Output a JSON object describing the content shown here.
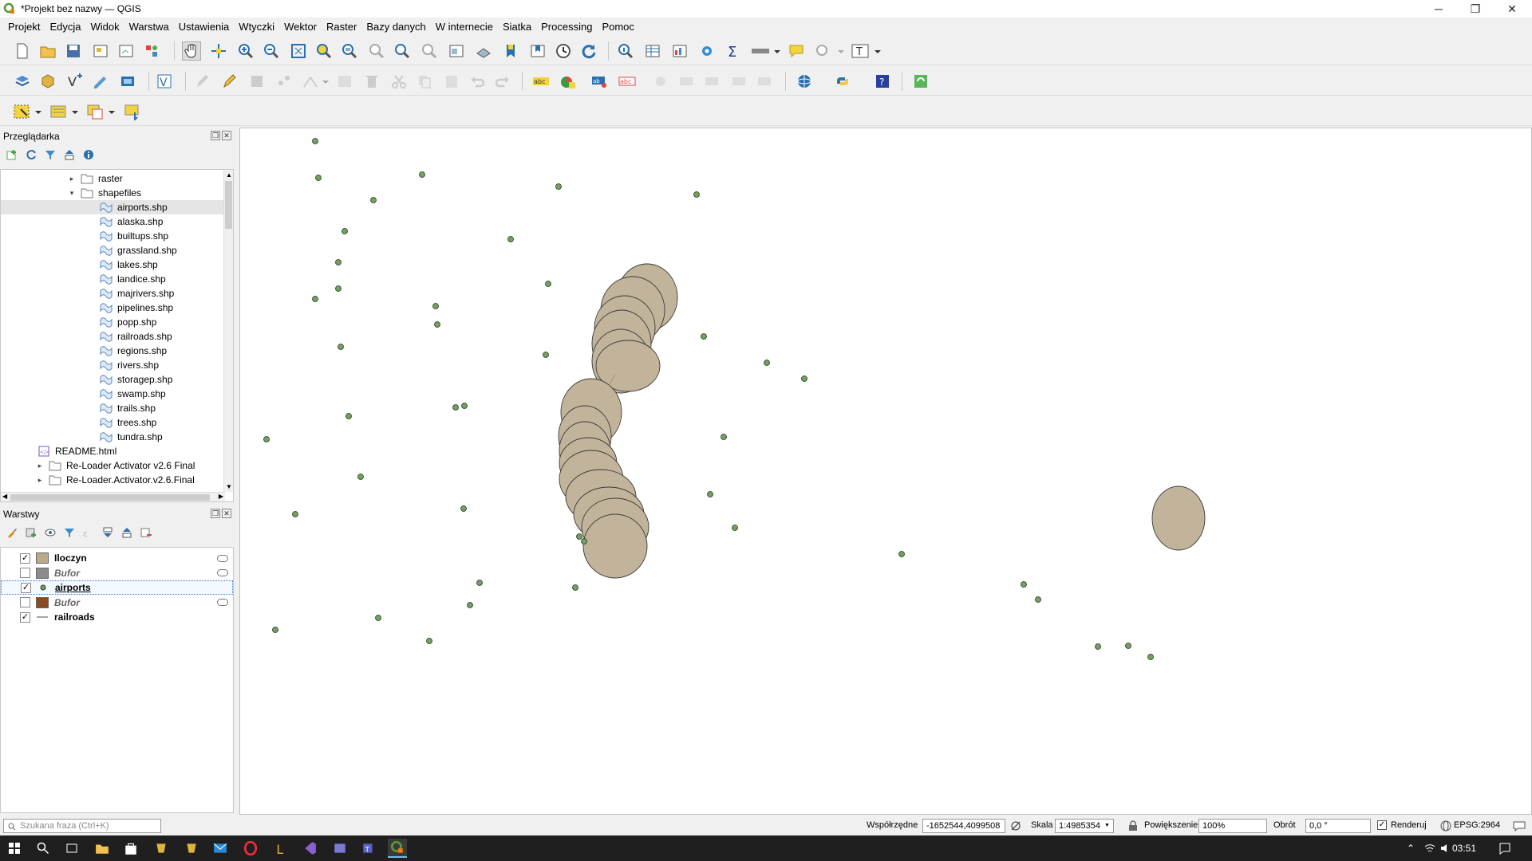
{
  "window": {
    "title": "*Projekt bez nazwy — QGIS",
    "controls": [
      "─",
      "❐",
      "✕"
    ]
  },
  "menu": [
    "Projekt",
    "Edycja",
    "Widok",
    "Warstwa",
    "Ustawienia",
    "Wtyczki",
    "Wektor",
    "Raster",
    "Bazy danych",
    "W internecie",
    "Siatka",
    "Processing",
    "Pomoc"
  ],
  "browser": {
    "title": "Przeglądarka",
    "items": [
      {
        "label": "raster",
        "type": "folder",
        "expanded": false
      },
      {
        "label": "shapefiles",
        "type": "folder",
        "expanded": true
      },
      {
        "label": "airports.shp",
        "type": "shp",
        "selected": true
      },
      {
        "label": "alaska.shp",
        "type": "shp"
      },
      {
        "label": "builtups.shp",
        "type": "shp"
      },
      {
        "label": "grassland.shp",
        "type": "shp"
      },
      {
        "label": "lakes.shp",
        "type": "shp"
      },
      {
        "label": "landice.shp",
        "type": "shp"
      },
      {
        "label": "majrivers.shp",
        "type": "shp"
      },
      {
        "label": "pipelines.shp",
        "type": "shp"
      },
      {
        "label": "popp.shp",
        "type": "shp"
      },
      {
        "label": "railroads.shp",
        "type": "shp"
      },
      {
        "label": "regions.shp",
        "type": "shp"
      },
      {
        "label": "rivers.shp",
        "type": "shp"
      },
      {
        "label": "storagep.shp",
        "type": "shp"
      },
      {
        "label": "swamp.shp",
        "type": "shp"
      },
      {
        "label": "trails.shp",
        "type": "shp"
      },
      {
        "label": "trees.shp",
        "type": "shp"
      },
      {
        "label": "tundra.shp",
        "type": "shp"
      },
      {
        "label": "README.html",
        "type": "html"
      },
      {
        "label": "Re-Loader Activator v2.6 Final",
        "type": "folder",
        "expanded": false
      },
      {
        "label": "Re-Loader.Activator.v2.6.Final",
        "type": "folder",
        "expanded": false
      }
    ]
  },
  "layers": {
    "title": "Warstwy",
    "items": [
      {
        "label": "Iloczyn",
        "checked": true,
        "color": "#b9aa8a",
        "italic": false
      },
      {
        "label": "Bufor",
        "checked": false,
        "color": "#8c8c8c",
        "italic": true
      },
      {
        "label": "airports",
        "checked": true,
        "color": "#6fa35a",
        "italic": false,
        "point": true,
        "selected": true
      },
      {
        "label": "Bufor",
        "checked": false,
        "color": "#8b4a1f",
        "italic": true
      },
      {
        "label": "railroads",
        "checked": true,
        "color": "#888888",
        "italic": false,
        "line": true
      }
    ]
  },
  "status": {
    "search_placeholder": "Szukana fraza (Ctrl+K)",
    "coords_label": "Współrzędne",
    "coords_value": "-1652544,4099508",
    "scale_label": "Skala",
    "scale_value": "1:4985354",
    "zoom_label": "Powiększenie",
    "zoom_value": "100%",
    "rotation_label": "Obrót",
    "rotation_value": "0,0 °",
    "render_label": "Renderuj",
    "epsg": "EPSG:2964"
  },
  "taskbar": {
    "time": "03:51"
  },
  "colors": {
    "airport_fill": "#6fa35a",
    "polygon_fill": "#c2b49a",
    "polygon_stroke": "#3a3a3a"
  }
}
